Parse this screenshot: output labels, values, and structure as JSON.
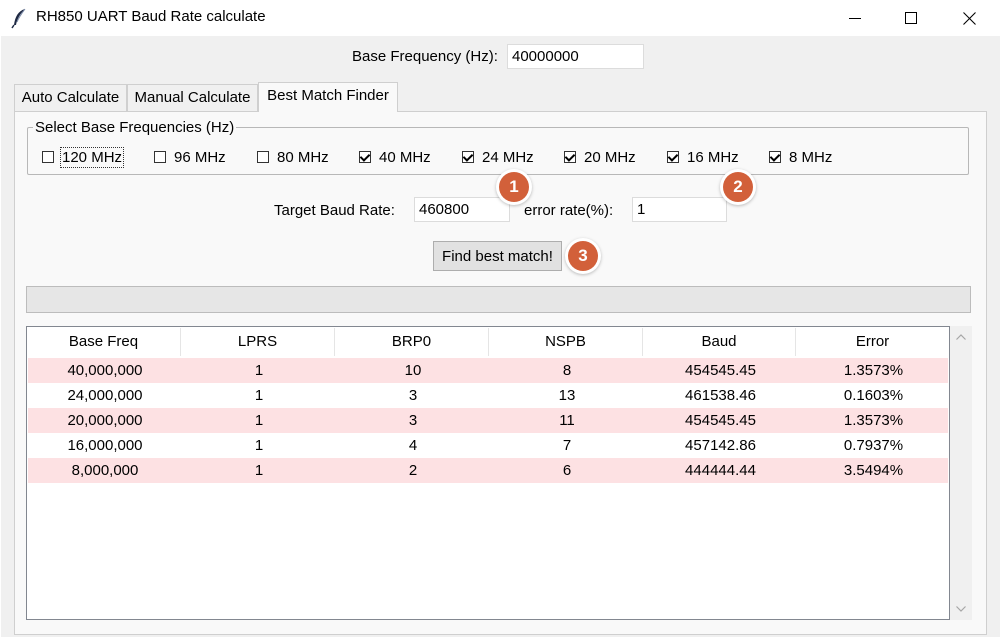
{
  "window": {
    "title": "RH850 UART Baud Rate calculate",
    "app_icon": "feather-icon",
    "controls": [
      "minimize-icon",
      "maximize-icon",
      "close-icon"
    ]
  },
  "base_frequency": {
    "label": "Base Frequency (Hz):",
    "value": "40000000"
  },
  "tabs": [
    {
      "label": "Auto Calculate",
      "active": false
    },
    {
      "label": "Manual Calculate",
      "active": false
    },
    {
      "label": "Best Match Finder",
      "active": true
    }
  ],
  "freq_select": {
    "legend": "Select Base Frequencies (Hz)",
    "options": [
      {
        "label": "120 MHz",
        "checked": false
      },
      {
        "label": "96 MHz",
        "checked": false
      },
      {
        "label": "80 MHz",
        "checked": false
      },
      {
        "label": "40 MHz",
        "checked": true
      },
      {
        "label": "24 MHz",
        "checked": true
      },
      {
        "label": "20 MHz",
        "checked": true
      },
      {
        "label": "16 MHz",
        "checked": true
      },
      {
        "label": "8 MHz",
        "checked": true
      }
    ]
  },
  "target_baud": {
    "label": "Target Baud Rate:",
    "value": "460800"
  },
  "error_rate": {
    "label": "error rate(%):",
    "value": "1"
  },
  "find_button": {
    "label": "Find best match!"
  },
  "progress": {
    "fraction": 0
  },
  "badges": [
    "1",
    "2",
    "3"
  ],
  "results": {
    "columns": [
      "Base Freq",
      "LPRS",
      "BRP0",
      "NSPB",
      "Baud",
      "Error"
    ],
    "rows": [
      [
        "40,000,000",
        "1",
        "10",
        "8",
        "454545.45",
        "1.3573%"
      ],
      [
        "24,000,000",
        "1",
        "3",
        "13",
        "461538.46",
        "0.1603%"
      ],
      [
        "20,000,000",
        "1",
        "3",
        "11",
        "454545.45",
        "1.3573%"
      ],
      [
        "16,000,000",
        "1",
        "4",
        "7",
        "457142.86",
        "0.7937%"
      ],
      [
        "8,000,000",
        "1",
        "2",
        "6",
        "444444.44",
        "3.5494%"
      ]
    ]
  },
  "colors": {
    "row_highlight": "#fde1e3",
    "badge": "#d2603a",
    "panel_background": "#f0f0f0"
  }
}
